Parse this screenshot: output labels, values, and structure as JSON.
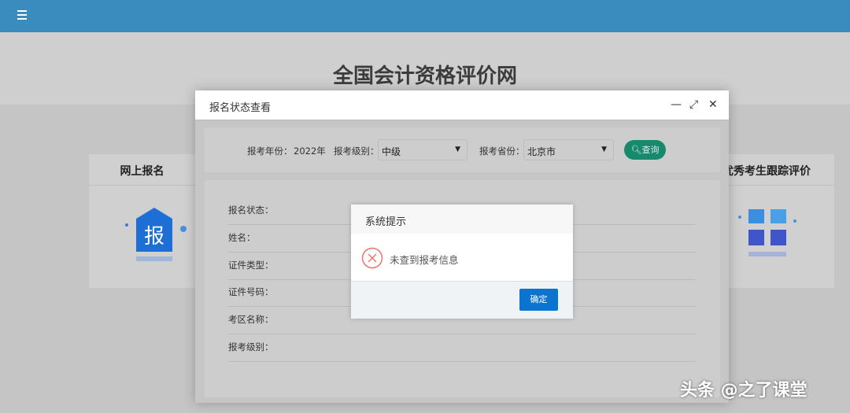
{
  "site": {
    "title": "全国会计资格评价网"
  },
  "cards": {
    "left": "网上报名",
    "left_icon_text": "报",
    "right": "优秀考生跟踪评价"
  },
  "dialog": {
    "title": "报名状态查看",
    "search": {
      "year_label": "报考年份：",
      "year_value": "2022年",
      "level_label": "报考级别：",
      "level_value": "中级",
      "province_label": "报考省份：",
      "province_value": "北京市",
      "query_label": "查询"
    },
    "fields": [
      "报名状态：",
      "姓名：",
      "证件类型：",
      "证件号码：",
      "考区名称：",
      "报考级别："
    ]
  },
  "alert": {
    "title": "系统提示",
    "message": "未查到报考信息",
    "ok_label": "确定",
    "error_color": "#e8766a"
  },
  "watermark": "头条 @之了课堂"
}
